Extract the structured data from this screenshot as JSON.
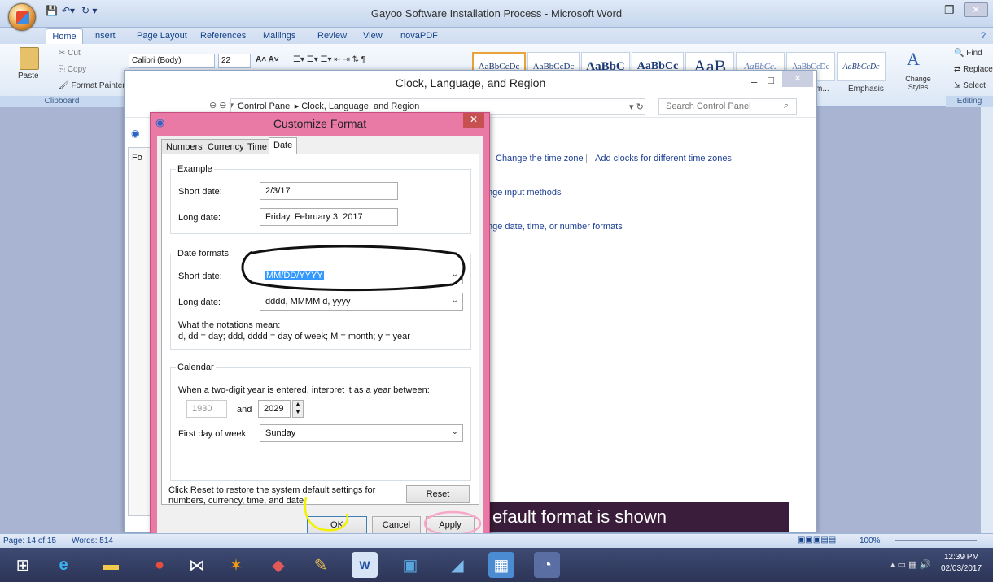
{
  "word": {
    "window_title": "Gayoo Software Installation Process - Microsoft Word",
    "tabs": [
      "Home",
      "Insert",
      "Page Layout",
      "References",
      "Mailings",
      "Review",
      "View",
      "novaPDF"
    ],
    "clipboard": {
      "cut": "Cut",
      "copy": "Copy",
      "paste": "Paste",
      "format_painter": "Format Painter",
      "group": "Clipboard"
    },
    "font": {
      "name": "Calibri (Body)",
      "size": "22"
    },
    "styles": [
      "AaBbCcDc",
      "AaBbCcDc",
      "AaBbC",
      "AaBbCc",
      "AaB",
      "AaBbCc.",
      "AaBbCcDc",
      "AaBbCcDc"
    ],
    "styles_labels": {
      "emphasis": "Emphasis",
      "partial": "m..."
    },
    "change_styles": "Change Styles",
    "editing": {
      "find": "Find",
      "replace": "Replace",
      "select": "Select",
      "group": "Editing"
    },
    "status": {
      "page": "Page: 14 of 15",
      "words": "Words: 514",
      "zoom": "100%"
    },
    "caption_text": "efault format is shown"
  },
  "control_panel": {
    "title": "Clock, Language, and Region",
    "breadcrumb": "Control Panel  ▸  Clock, Language, and Region",
    "search_placeholder": "Search Control Panel",
    "links": {
      "time_zone": "Change the time zone",
      "add_clocks": "Add clocks for different time zones",
      "input_methods": "nge input methods",
      "formats": "nge date, time, or number formats"
    },
    "behind_dialog_label": "Fo"
  },
  "dialog": {
    "title": "Customize Format",
    "tabs": [
      "Numbers",
      "Currency",
      "Time",
      "Date"
    ],
    "example": {
      "legend": "Example",
      "short_label": "Short date:",
      "short_value": "2/3/17",
      "long_label": "Long date:",
      "long_value": "Friday, February 3, 2017"
    },
    "formats": {
      "legend": "Date formats",
      "short_label": "Short date:",
      "short_value": "MM/DD/YYYY",
      "long_label": "Long date:",
      "long_value": "dddd, MMMM d, yyyy",
      "notation_heading": "What the notations mean:",
      "notation_text": "d, dd = day;  ddd, dddd = day of week;  M = month;  y = year"
    },
    "calendar": {
      "legend": "Calendar",
      "two_digit_text": "When a two-digit year is entered, interpret it as a year between:",
      "from_year": "1930",
      "and_label": "and",
      "to_year": "2029",
      "first_day_label": "First day of week:",
      "first_day_value": "Sunday"
    },
    "reset_text": "Click Reset to restore the system default settings for numbers, currency, time, and date.",
    "reset_button": "Reset",
    "ok_button": "OK",
    "cancel_button": "Cancel",
    "apply_button": "Apply"
  },
  "taskbar": {
    "time": "12:39 PM",
    "date": "02/03/2017"
  },
  "colors": {
    "dialog_frame": "#e97aa6",
    "annotation_black": "#111111",
    "annotation_yellow": "#f2f200",
    "annotation_pink": "#f7a8c8"
  }
}
